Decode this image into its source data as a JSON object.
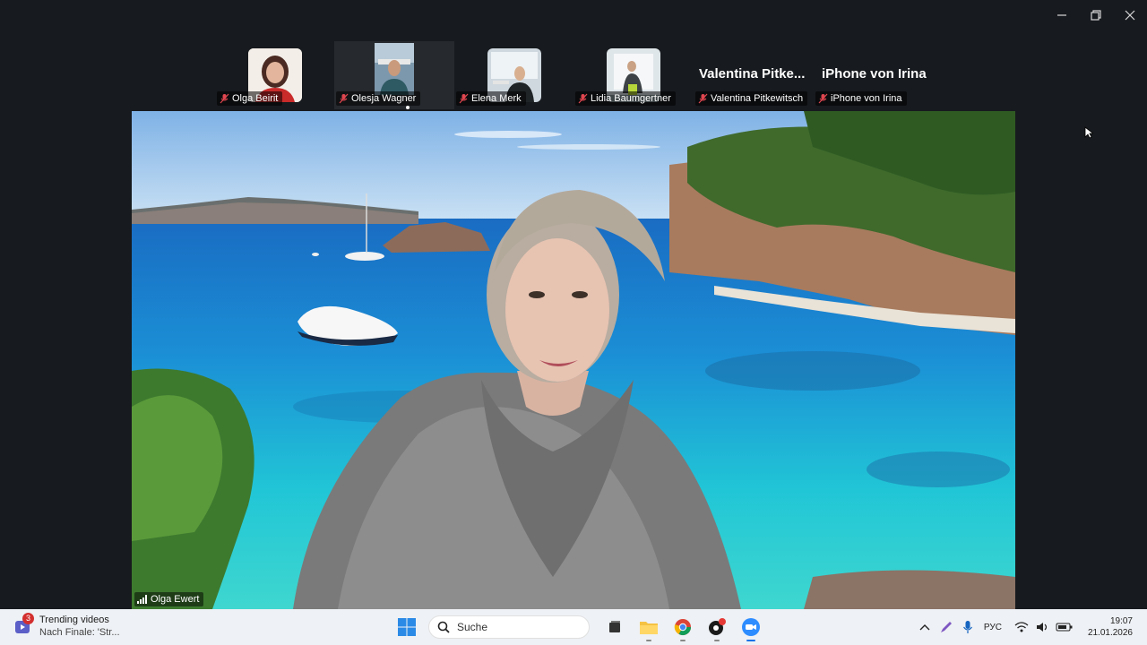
{
  "window": {
    "controls": [
      "minimize-icon",
      "restore-icon",
      "close-icon"
    ]
  },
  "participants": [
    {
      "name": "Olga Beirit",
      "type": "video"
    },
    {
      "name": "Olesja Wagner",
      "type": "video",
      "active": true
    },
    {
      "name": "Elena Merk",
      "type": "video"
    },
    {
      "name": "Lidia Baumgertner",
      "type": "video"
    },
    {
      "display_name": "Valentina  Pitke...",
      "name": "Valentina Pitkewitsch",
      "type": "name-only"
    },
    {
      "display_name": "iPhone von Irina",
      "name": "iPhone von Irina",
      "type": "name-only"
    }
  ],
  "main_video": {
    "speaker": "Olga Ewert"
  },
  "taskbar": {
    "news_badge": "3",
    "news_title": "Trending videos",
    "news_subtitle": "Nach Finale: 'Str...",
    "search_placeholder": "Suche",
    "language": "РУС",
    "time": "19:07",
    "date": "21.01.2026"
  },
  "colors": {
    "background": "#171a1e",
    "taskbar": "#eef1f5",
    "mic_muted": "#e0464f"
  }
}
